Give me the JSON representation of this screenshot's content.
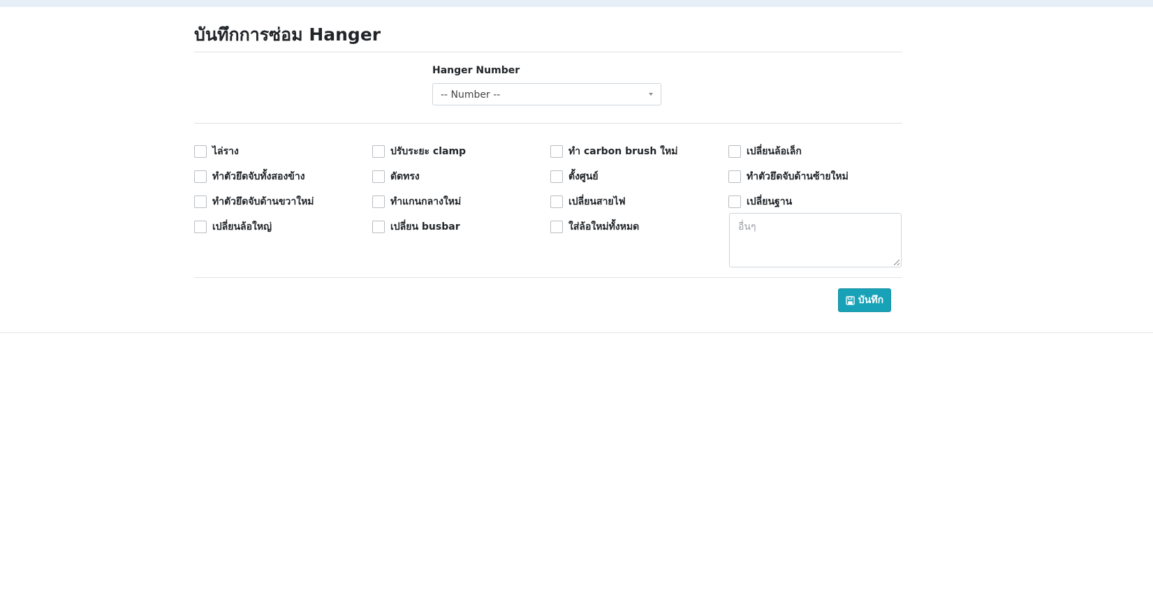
{
  "page": {
    "title": "บันทึกการซ่อม Hanger"
  },
  "form": {
    "hanger_number_label": "Hanger Number",
    "hanger_number_select": {
      "selected": "-- Number --"
    },
    "checkboxes": [
      {
        "label": "ไล่ราง",
        "checked": false
      },
      {
        "label": "ปรับระยะ clamp",
        "checked": false
      },
      {
        "label": "ทำ carbon brush ใหม่",
        "checked": false
      },
      {
        "label": "เปลี่ยนล้อเล็ก",
        "checked": false
      },
      {
        "label": "ทำตัวยึดจับทั้งสองข้าง",
        "checked": false
      },
      {
        "label": "ดัดทรง",
        "checked": false
      },
      {
        "label": "ตั้งศูนย์",
        "checked": false
      },
      {
        "label": "ทำตัวยึดจับด้านซ้ายใหม่",
        "checked": false
      },
      {
        "label": "ทำตัวยึดจับด้านขวาใหม่",
        "checked": false
      },
      {
        "label": "ทำแกนกลางใหม่",
        "checked": false
      },
      {
        "label": "เปลี่ยนสายไฟ",
        "checked": false
      },
      {
        "label": "เปลี่ยนฐาน",
        "checked": false
      },
      {
        "label": "เปลี่ยนล้อใหญ่",
        "checked": false
      },
      {
        "label": "เปลี่ยน busbar",
        "checked": false
      },
      {
        "label": "ใส่ล้อใหม่ทั้งหมด",
        "checked": false
      }
    ],
    "other_placeholder": "อื่นๆ",
    "save_label": "บันทึก"
  },
  "icons": {
    "save": "floppy-disk-icon",
    "select_caret": "caret-down-icon"
  },
  "colors": {
    "primary_button": "#17a2b8",
    "title_text": "#212529",
    "border": "#ced4da"
  }
}
